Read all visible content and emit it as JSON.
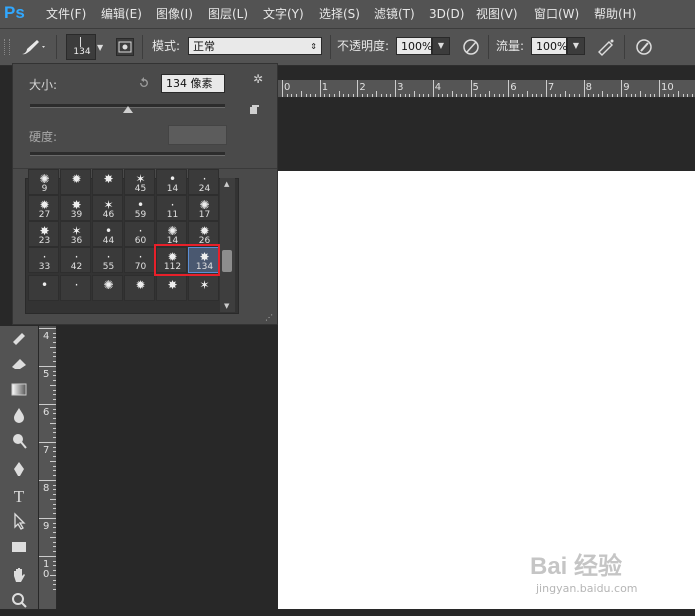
{
  "app": {
    "logo": "Ps"
  },
  "menu": [
    "文件(F)",
    "编辑(E)",
    "图像(I)",
    "图层(L)",
    "文字(Y)",
    "选择(S)",
    "滤镜(T)",
    "3D(D)",
    "视图(V)",
    "窗口(W)",
    "帮助(H)"
  ],
  "options": {
    "brush_size": "134",
    "mode_label": "模式:",
    "mode_value": "正常",
    "opacity_label": "不透明度:",
    "opacity_value": "100%",
    "flow_label": "流量:",
    "flow_value": "100%"
  },
  "brush_panel": {
    "size_label": "大小:",
    "size_value": "134 像素",
    "hardness_label": "硬度:",
    "size_slider_fraction": 0.5,
    "rows": [
      [
        "9",
        "",
        "",
        "45",
        "14",
        "24"
      ],
      [
        "27",
        "39",
        "46",
        "59",
        "11",
        "17"
      ],
      [
        "23",
        "36",
        "44",
        "60",
        "14",
        "26"
      ],
      [
        "33",
        "42",
        "55",
        "70",
        "112",
        "134"
      ],
      [
        "",
        "",
        "",
        "",
        "",
        ""
      ]
    ],
    "selected": "134",
    "highlighted": [
      "112",
      "134"
    ]
  },
  "ruler_top": [
    "0",
    "1",
    "2",
    "3",
    "4",
    "5",
    "6",
    "7",
    "8",
    "9",
    "10"
  ],
  "ruler_left": [
    "4",
    "5",
    "6",
    "7",
    "8",
    "9",
    "1 0"
  ],
  "tools": [
    "stamp-icon",
    "eraser-icon",
    "gradient-icon",
    "blur-drop-icon",
    "dodge-icon",
    "pen-icon",
    "type-icon",
    "path-select-icon",
    "rectangle-icon",
    "hand-icon",
    "zoom-icon"
  ],
  "tool_type_glyph": "T",
  "watermark": {
    "brand": "Bai 经验",
    "url": "jingyan.baidu.com"
  },
  "colors": {
    "accent_red": "#e8202a",
    "selected_blue": "#5b8fd6",
    "logo_blue": "#31a8ff"
  }
}
